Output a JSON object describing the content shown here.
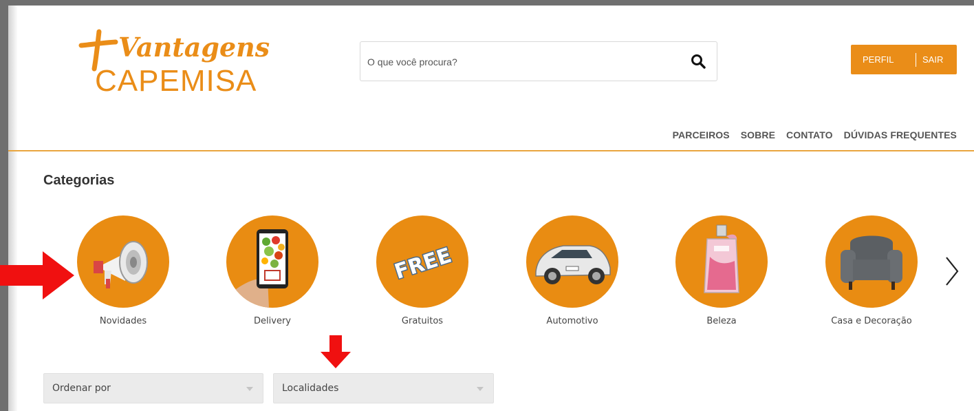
{
  "brand": {
    "logo_line1": "Vantagens",
    "logo_line2": "CAPEMISA",
    "accent_color": "#ea8d18"
  },
  "search": {
    "placeholder": "O que você procura?",
    "icon": "search-icon"
  },
  "account": {
    "profile_label": "PERFIL",
    "logout_label": "SAIR"
  },
  "nav": {
    "items": [
      "PARCEIROS",
      "SOBRE",
      "CONTATO",
      "DÚVIDAS FREQUENTES"
    ]
  },
  "categories": {
    "title": "Categorias",
    "items": [
      {
        "label": "Novidades",
        "icon": "megaphone-icon"
      },
      {
        "label": "Delivery",
        "icon": "phone-groceries-icon"
      },
      {
        "label": "Gratuitos",
        "icon": "free-tag-icon"
      },
      {
        "label": "Automotivo",
        "icon": "car-icon"
      },
      {
        "label": "Beleza",
        "icon": "perfume-icon"
      },
      {
        "label": "Casa e Decoração",
        "icon": "armchair-icon"
      }
    ],
    "next_icon": "chevron-right-icon"
  },
  "filters": {
    "sort_label": "Ordenar por",
    "location_label": "Localidades"
  }
}
